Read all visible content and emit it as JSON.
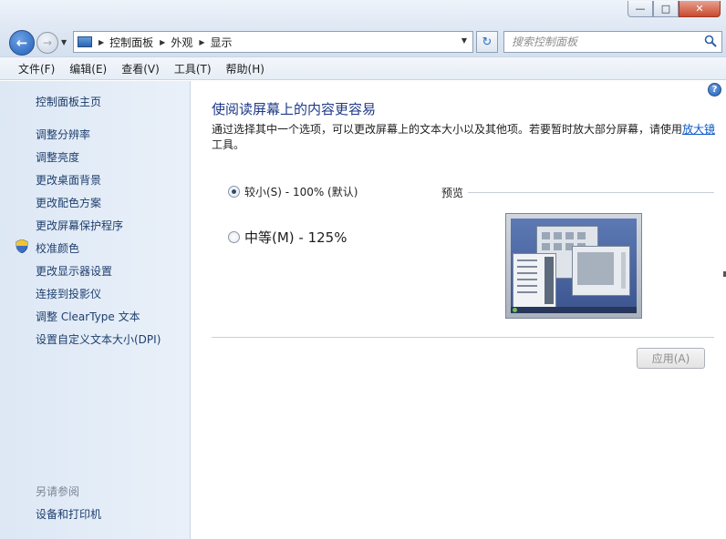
{
  "window": {
    "caption": {
      "minimize": "—",
      "maximize": "□",
      "close": "✕"
    }
  },
  "nav": {
    "back_glyph": "←",
    "forward_glyph": "→",
    "breadcrumbs": [
      "控制面板",
      "外观",
      "显示"
    ],
    "search_placeholder": "搜索控制面板",
    "refresh_glyph": "↻",
    "icons": [
      "back-arrow-icon",
      "forward-arrow-icon",
      "control-panel-icon",
      "refresh-icon",
      "search-icon"
    ]
  },
  "menubar": {
    "items": [
      "文件(F)",
      "编辑(E)",
      "查看(V)",
      "工具(T)",
      "帮助(H)"
    ]
  },
  "leftpane": {
    "home": "控制面板主页",
    "links": [
      "调整分辨率",
      "调整亮度",
      "更改桌面背景",
      "更改配色方案",
      "更改屏幕保护程序",
      "校准颜色",
      "更改显示器设置",
      "连接到投影仪",
      "调整 ClearType 文本",
      "设置自定义文本大小(DPI)"
    ],
    "see_also_heading": "另请参阅",
    "see_also_links": [
      "设备和打印机"
    ]
  },
  "main": {
    "title": "使阅读屏幕上的内容更容易",
    "description_prefix": "通过选择其中一个选项，可以更改屏幕上的文本大小以及其他项。若要暂时放大部分屏幕，请使用",
    "description_link": "放大镜",
    "description_suffix": "工具。",
    "options": [
      {
        "label": "较小(S) - 100% (默认)",
        "selected": true
      },
      {
        "label": "中等(M) - 125%",
        "selected": false
      }
    ],
    "preview_label": "预览",
    "apply_label": "应用(A)",
    "help_glyph": "?"
  }
}
